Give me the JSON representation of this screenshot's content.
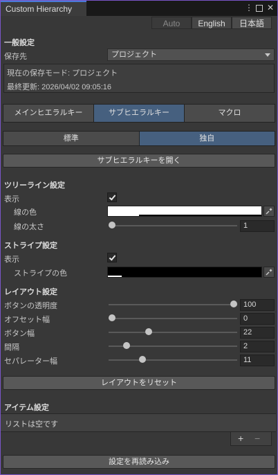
{
  "window": {
    "title": "Custom Hierarchy",
    "menu_icon": "kebab-icon",
    "maximize_icon": "maximize-icon",
    "close_icon": "close-icon"
  },
  "language": {
    "options": [
      "Auto",
      "English",
      "日本語"
    ],
    "selected": "English"
  },
  "general": {
    "heading": "一般設定",
    "save_location_label": "保存先",
    "save_location_value": "プロジェクト",
    "current_mode": "現在の保存モード: プロジェクト",
    "last_updated": "最終更新: 2026/04/02 09:05:16"
  },
  "key_tabs": {
    "items": [
      "メインヒエラルキー",
      "サブヒエラルキー",
      "マクロ"
    ],
    "selected": "サブヒエラルキー"
  },
  "mode_tabs": {
    "items": [
      "標準",
      "独自"
    ],
    "selected": "独自"
  },
  "open_button": "サブヒエラルキーを開く",
  "tree_line": {
    "heading": "ツリーライン設定",
    "display_label": "表示",
    "display_checked": true,
    "color_label": "線の色",
    "color": "#ffffff",
    "alpha": 0.2,
    "thickness_label": "線の太さ",
    "thickness_value": "1",
    "thickness_fraction": 0.0
  },
  "stripe": {
    "heading": "ストライプ設定",
    "display_label": "表示",
    "display_checked": true,
    "color_label": "ストライプの色",
    "color": "#000000",
    "alpha": 0.1
  },
  "layout": {
    "heading": "レイアウト設定",
    "rows": [
      {
        "label": "ボタンの透明度",
        "value": "100",
        "fraction": 1.0
      },
      {
        "label": "オフセット幅",
        "value": "0",
        "fraction": 0.0
      },
      {
        "label": "ボタン幅",
        "value": "22",
        "fraction": 0.3
      },
      {
        "label": "間隔",
        "value": "2",
        "fraction": 0.12
      },
      {
        "label": "セパレーター幅",
        "value": "11",
        "fraction": 0.25
      }
    ],
    "reset_button": "レイアウトをリセット"
  },
  "items": {
    "heading": "アイテム設定",
    "empty_text": "リストは空です",
    "add": "+",
    "remove": "−"
  },
  "reload_button": "設定を再読み込み",
  "colors": {
    "accent_tab": "#46607f",
    "frame": "#7a55c8"
  }
}
